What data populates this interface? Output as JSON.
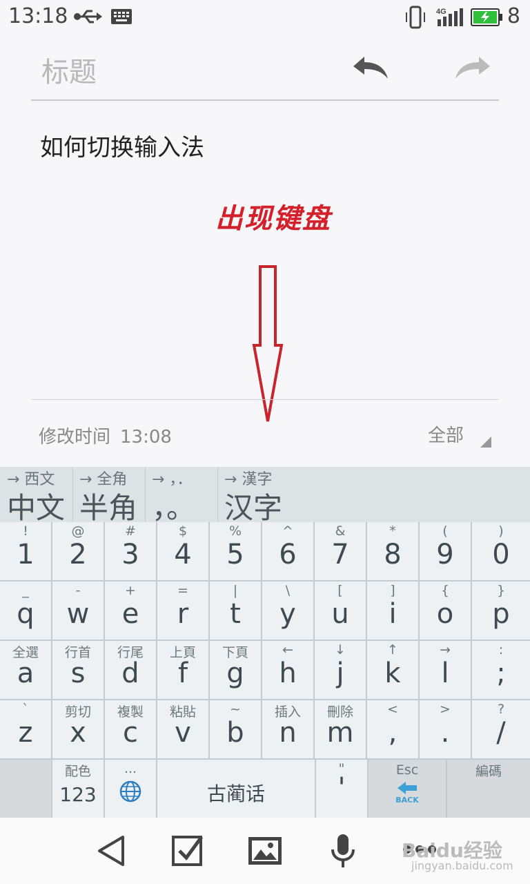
{
  "status_bar": {
    "time": "13:18",
    "battery_level": "8",
    "network": "4G"
  },
  "editor": {
    "title_placeholder": "标题",
    "body_text": "如何切换输入法",
    "overlay_text": "出现键盘",
    "modified_label": "修改时间",
    "modified_time": "13:08",
    "folder_label": "全部"
  },
  "candidates": [
    {
      "hint": "→ 西文",
      "text": "中文"
    },
    {
      "hint": "→ 全角",
      "text": "半角"
    },
    {
      "hint": "→ ，．",
      "text": "，。"
    },
    {
      "hint": "→ 漢字",
      "text": "汉字"
    }
  ],
  "keyboard": {
    "row1": [
      {
        "top": "!",
        "main": "1"
      },
      {
        "top": "@",
        "main": "2"
      },
      {
        "top": "#",
        "main": "3"
      },
      {
        "top": "$",
        "main": "4"
      },
      {
        "top": "%",
        "main": "5"
      },
      {
        "top": "^",
        "main": "6"
      },
      {
        "top": "&",
        "main": "7"
      },
      {
        "top": "*",
        "main": "8"
      },
      {
        "top": "(",
        "main": "9"
      },
      {
        "top": ")",
        "main": "0"
      }
    ],
    "row2": [
      {
        "top": "_",
        "main": "q"
      },
      {
        "top": "-",
        "main": "w"
      },
      {
        "top": "+",
        "main": "e"
      },
      {
        "top": "=",
        "main": "r"
      },
      {
        "top": "|",
        "main": "t"
      },
      {
        "top": "\\",
        "main": "y"
      },
      {
        "top": "[",
        "main": "u"
      },
      {
        "top": "]",
        "main": "i"
      },
      {
        "top": "{",
        "main": "o"
      },
      {
        "top": "}",
        "main": "p"
      }
    ],
    "row3": [
      {
        "top": "全選",
        "main": "a"
      },
      {
        "top": "行首",
        "main": "s"
      },
      {
        "top": "行尾",
        "main": "d"
      },
      {
        "top": "上頁",
        "main": "f"
      },
      {
        "top": "下頁",
        "main": "g"
      },
      {
        "top": "←",
        "main": "h"
      },
      {
        "top": "↓",
        "main": "j"
      },
      {
        "top": "↑",
        "main": "k"
      },
      {
        "top": "→",
        "main": "l"
      },
      {
        "top": ":",
        "main": ";"
      }
    ],
    "row4": [
      {
        "top": "`",
        "main": "z"
      },
      {
        "top": "剪切",
        "main": "x"
      },
      {
        "top": "複製",
        "main": "c"
      },
      {
        "top": "粘貼",
        "main": "v"
      },
      {
        "top": "~",
        "main": "b"
      },
      {
        "top": "插入",
        "main": "n"
      },
      {
        "top": "刪除",
        "main": "m"
      },
      {
        "top": "<",
        "main": ","
      },
      {
        "top": ">",
        "main": "."
      },
      {
        "top": "?",
        "main": "/"
      }
    ],
    "bottom": {
      "config_top": "配色",
      "num_label": "123",
      "globe_top": "...",
      "space_label": "古蔺话",
      "quote_top": "\"",
      "quote_main": "'",
      "esc_top": "Esc",
      "back_label": "BACK",
      "code_label": "編碼"
    }
  },
  "watermark": {
    "line1": "Baidu经验",
    "line2": "jingyan.baidu.com"
  },
  "colors": {
    "overlay_red": "#d3202a",
    "accent_blue": "#3aa0d6"
  }
}
